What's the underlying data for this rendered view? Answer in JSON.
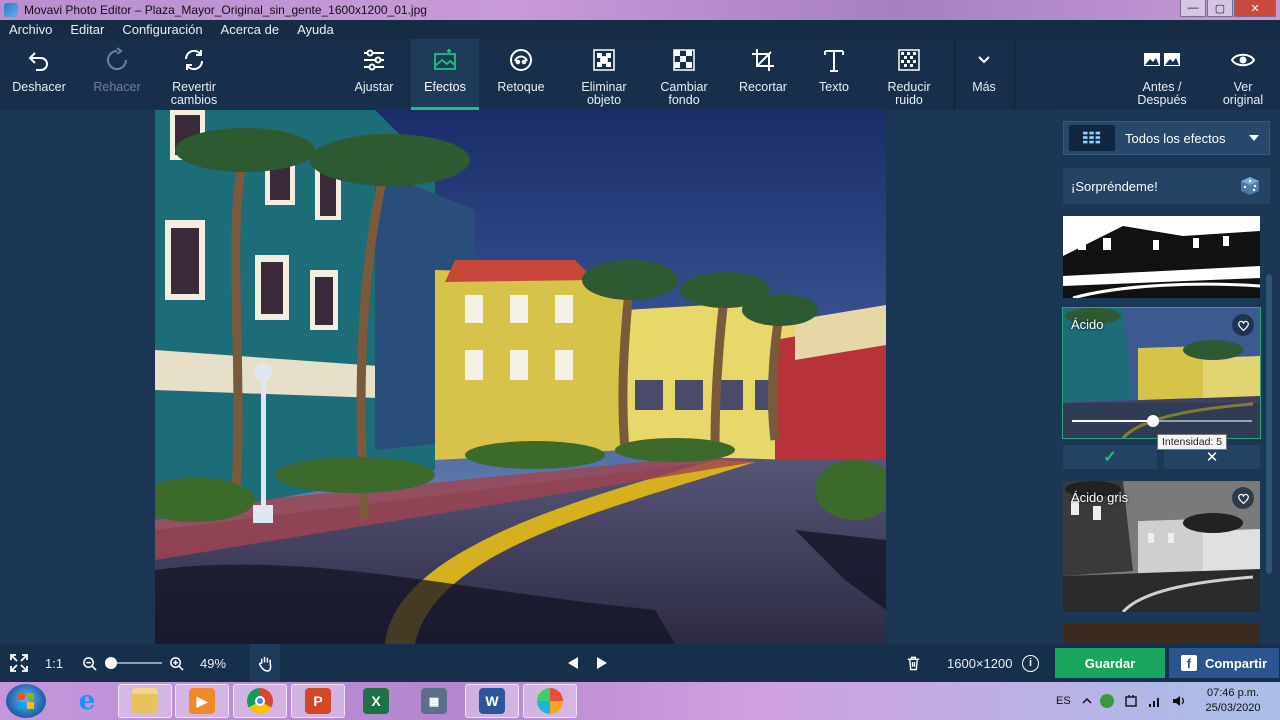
{
  "window": {
    "title": "Movavi Photo Editor – Plaza_Mayor_Original_sin_gente_1600x1200_01.jpg",
    "controls": {
      "minimize": "—",
      "maximize": "▢",
      "close": "✕"
    }
  },
  "menu": [
    "Archivo",
    "Editar",
    "Configuración",
    "Acerca de",
    "Ayuda"
  ],
  "toolbar": {
    "undo": "Deshacer",
    "redo": "Rehacer",
    "revert_1": "Revertir",
    "revert_2": "cambios",
    "adjust": "Ajustar",
    "effects": "Efectos",
    "retouch": "Retoque",
    "remove_1": "Eliminar",
    "remove_2": "objeto",
    "bg_1": "Cambiar",
    "bg_2": "fondo",
    "crop": "Recortar",
    "text": "Texto",
    "noise_1": "Reducir",
    "noise_2": "ruido",
    "more": "Más",
    "before_1": "Antes /",
    "before_2": "Después",
    "original_1": "Ver",
    "original_2": "original",
    "active_tool": "Efectos"
  },
  "panel": {
    "category": "Todos los efectos",
    "surprise": "¡Sorpréndeme!",
    "effects": [
      {
        "name": "Ácido"
      },
      {
        "name": "Ácido gris"
      }
    ],
    "tooltip": "Intensidad: 5",
    "intensity": 5,
    "apply_icon": "✓",
    "cancel_icon": "✕"
  },
  "bottom": {
    "ratio": "1:1",
    "zoom": "49%",
    "dimensions": "1600×1200",
    "info_icon": "i",
    "save": "Guardar",
    "share": "Compartir"
  },
  "taskbar": {
    "language": "ES",
    "time": "07:46 p.m.",
    "date": "25/03/2020",
    "apps": [
      "internet-explorer",
      "file-explorer",
      "media-player",
      "chrome",
      "powerpoint",
      "excel",
      "calculator",
      "word",
      "movavi"
    ]
  },
  "colors": {
    "accent_green": "#19c37d",
    "save_green": "#18a65f",
    "share_blue": "#2c5590",
    "toolbar_bg": "#172f4a"
  }
}
